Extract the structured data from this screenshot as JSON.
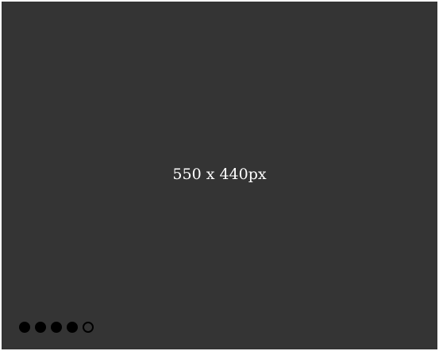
{
  "slider": {
    "image_placeholder_text": "550 x 440px",
    "pagination": {
      "total": 5,
      "active_index": 4
    },
    "colors": {
      "background": "#343434",
      "text": "#ffffff",
      "dot": "#000000"
    },
    "icons": {
      "pagination_dot": "circle-dot-icon"
    }
  }
}
